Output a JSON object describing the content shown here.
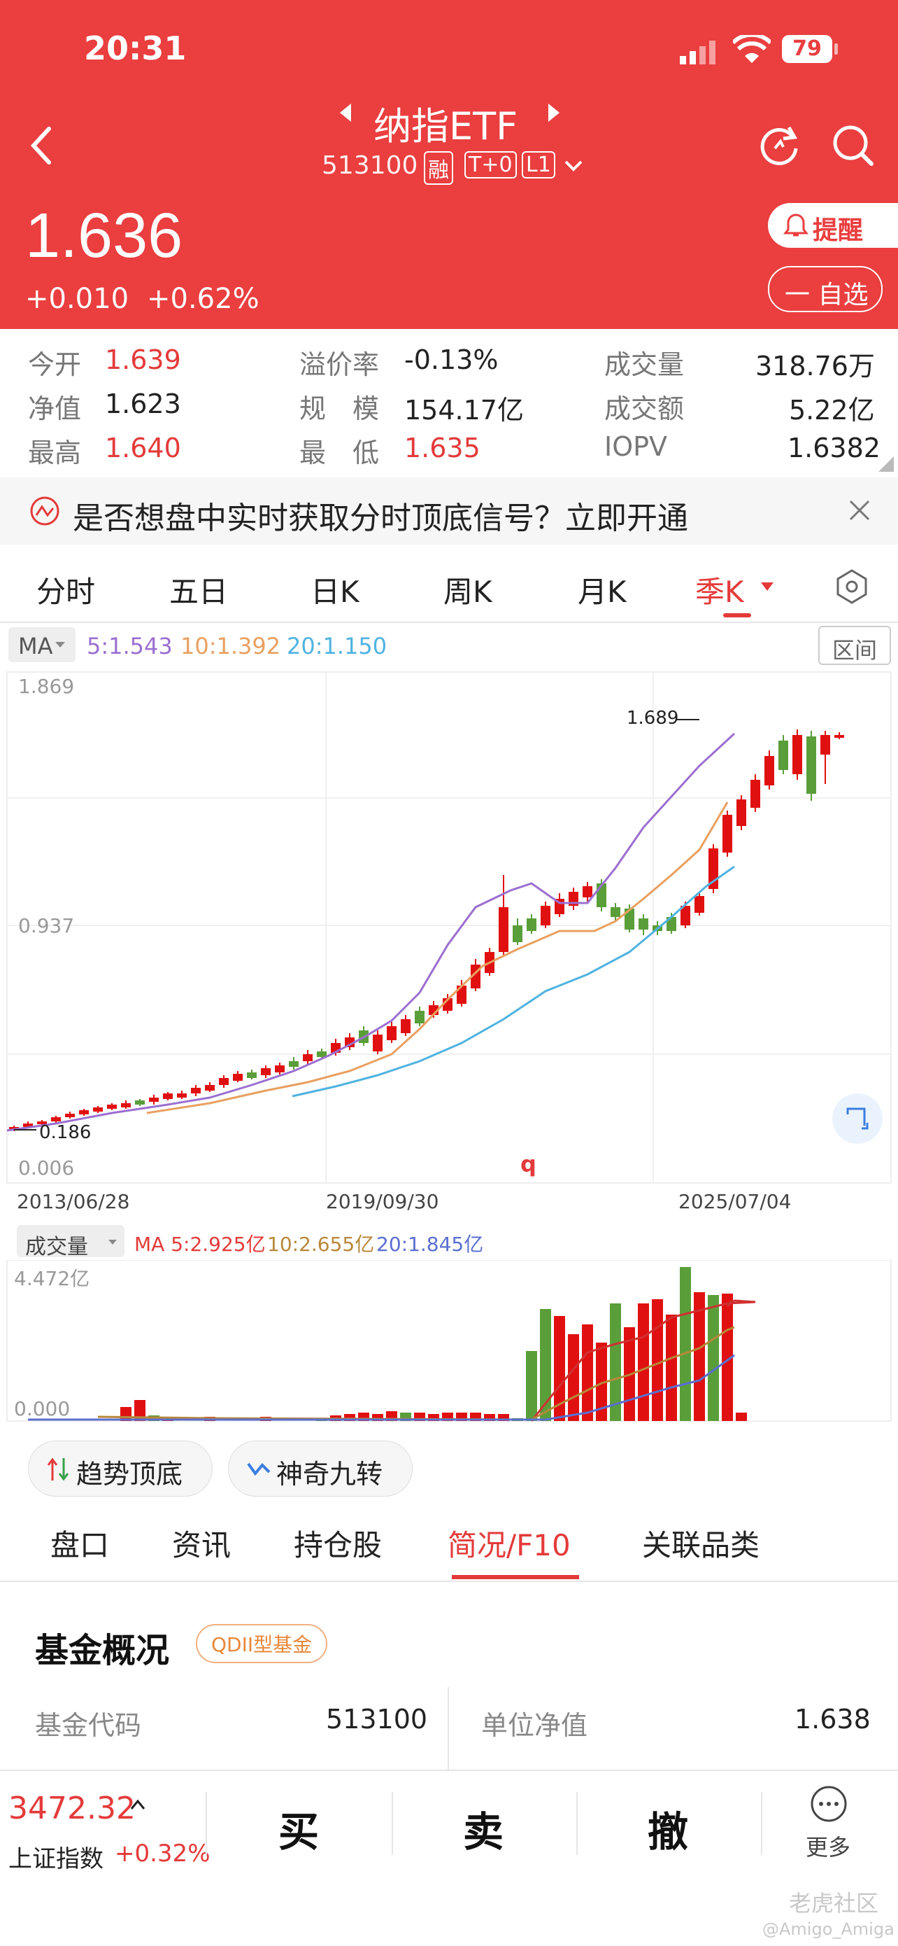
{
  "status_bar": {
    "time": "20:31",
    "battery": "79"
  },
  "header": {
    "title": "纳指ETF",
    "code": "513100",
    "badge_margin": "融",
    "badge_t0": "T+0",
    "badge_level": "L1",
    "price": "1.636",
    "change": "+0.010",
    "change_pct": "+0.62%",
    "alert_label": "提醒",
    "watchlist_label": "一 自选"
  },
  "quote": {
    "open_label": "今开",
    "open": "1.639",
    "premium_label": "溢价率",
    "premium": "-0.13%",
    "volume_label": "成交量",
    "volume": "318.76万",
    "nav_label": "净值",
    "nav": "1.623",
    "scale_label": "规　模",
    "scale": "154.17亿",
    "amount_label": "成交额",
    "amount": "5.22亿",
    "high_label": "最高",
    "high": "1.640",
    "low_label": "最　低",
    "low": "1.635",
    "iopv_label": "IOPV",
    "iopv": "1.6382"
  },
  "banner": {
    "text": "是否想盘中实时获取分时顶底信号？立即开通"
  },
  "chart_tabs": [
    "分时",
    "五日",
    "日K",
    "周K",
    "月K",
    "季K"
  ],
  "chart_tab_active": "季K",
  "ma_legend": {
    "selector": "MA",
    "ma5": "5:1.543",
    "ma10": "10:1.392",
    "ma20": "20:1.150",
    "interval_button": "区间"
  },
  "price_chart": {
    "y_max_label": "1.869",
    "y_mid_label": "0.937",
    "y_min_label": "0.006",
    "high_marker": "1.689",
    "low_marker": "0.186",
    "x_labels": [
      "2013/06/28",
      "2019/09/30",
      "2025/07/04"
    ],
    "event_marker": "q"
  },
  "volume_legend": {
    "selector": "成交量",
    "ma5": "MA 5:2.925亿",
    "ma10": "10:2.655亿",
    "ma20": "20:1.845亿"
  },
  "volume_chart": {
    "y_max_label": "4.472亿",
    "y_min_label": "0.000"
  },
  "indicator_buttons": {
    "trend": "趋势顶底",
    "nine": "神奇九转"
  },
  "info_tabs": [
    "盘口",
    "资讯",
    "持仓股",
    "简况/F10",
    "关联品类"
  ],
  "info_tab_active": "简况/F10",
  "fund_overview": {
    "title": "基金概况",
    "type_badge": "QDII型基金",
    "code_label": "基金代码",
    "code_value": "513100",
    "nav_label": "单位净值",
    "nav_value": "1.638"
  },
  "bottom_bar": {
    "index_value": "3472.32",
    "index_name": "上证指数",
    "index_change": "+0.32%",
    "buy": "买",
    "sell": "卖",
    "cancel": "撤",
    "more": "更多"
  },
  "watermark": {
    "site": "老虎社区",
    "user": "@Amigo_Amiga"
  },
  "colors": {
    "brand_red": "#ea3e3f",
    "up_red": "#e01010",
    "down_green": "#5a9e3a",
    "ma5": "#9b6fd0",
    "ma10": "#e8a060",
    "ma20": "#4fb3e0"
  },
  "chart_data": [
    {
      "type": "candlestick",
      "title": "",
      "period": "quarterly",
      "ylim": [
        0.006,
        1.869
      ],
      "x_range": [
        "2013/06/28",
        "2025/07/04"
      ],
      "series": [
        {
          "name": "MA5",
          "last": 1.543
        },
        {
          "name": "MA10",
          "last": 1.392
        },
        {
          "name": "MA20",
          "last": 1.15
        }
      ],
      "annotations": [
        "1.689",
        "0.186"
      ]
    },
    {
      "type": "bar",
      "title": "",
      "ylim": [
        0,
        4.472
      ],
      "unit": "亿",
      "series": [
        {
          "name": "MA 5",
          "last": 2.925
        },
        {
          "name": "10",
          "last": 2.655
        },
        {
          "name": "20",
          "last": 1.845
        }
      ]
    }
  ]
}
